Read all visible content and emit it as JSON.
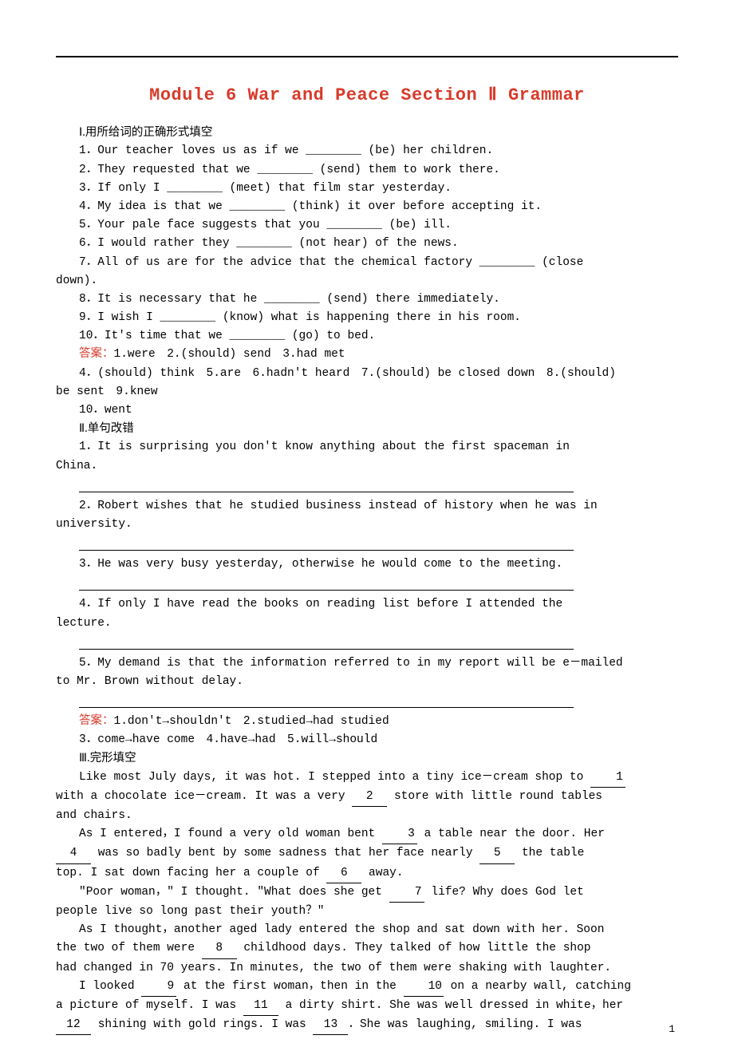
{
  "title": "Module 6 War and Peace Section Ⅱ Grammar",
  "sec1": {
    "head": "Ⅰ.用所给词的正确形式填空",
    "q1": "1．Our teacher loves us as if we ________ (be) her children.",
    "q2": "2．They requested that we ________ (send) them to work there.",
    "q3": "3．If only I ________ (meet) that film star yesterday.",
    "q4": "4．My idea is that we ________ (think) it over before accepting it.",
    "q5": "5．Your pale face suggests that you ________ (be) ill.",
    "q6": "6．I would rather they ________ (not hear) of the news.",
    "q7a": "7．All of us are for the advice that the chemical factory ________ (close",
    "q7b": "down).",
    "q8": "8．It is necessary that he ________ (send) there immediately.",
    "q9": "9．I wish I ________ (know) what is happening there in his room.",
    "q10": "10．It's time that we ________ (go) to bed.",
    "ans_label": "答案：",
    "ans_line1": "1.were　2.(should) send　3.had met",
    "ans_line2": "4．(should) think　5.are　6.hadn't heard　7.(should) be closed down　8.(should)",
    "ans_line2b": "be sent　9.knew",
    "ans_line3": "10．went"
  },
  "sec2": {
    "head": "Ⅱ.单句改错",
    "q1a": "1．It is surprising you don't know anything about the first spaceman in",
    "q1b": "China.",
    "q2a": "2．Robert wishes that he studied business instead of history when he was in",
    "q2b": "university.",
    "q3": "3．He was very busy yesterday, otherwise he would come to the meeting.",
    "q4a": "4．If only I have read the books on reading list before I attended the",
    "q4b": "lecture.",
    "q5a": "5．My demand is that the information referred to in my report will be e－mailed",
    "q5b": "to Mr. Brown without delay.",
    "ans_label": "答案：",
    "ans_line1": "1.don't→shouldn't　2.studied→had studied",
    "ans_line2": "3．come→have come　4.have→had　5.will→should"
  },
  "sec3": {
    "head": "Ⅲ.完形填空",
    "p1a": "Like most July days, it was hot. I stepped into a tiny ice－cream shop to ",
    "p1b": "with a chocolate ice－cream. It was a very ",
    "p1c": " store with little round tables",
    "p1d": "and chairs.",
    "p2a": "As I entered，I found a very old woman bent ",
    "p2b": " a table near the door. Her",
    "p2c": " was so badly bent by some sadness that her face nearly ",
    "p2d": " the table",
    "p2e": "top. I sat down facing her a couple of ",
    "p2f": " away.",
    "p3a": "\"Poor woman，\" I thought. \"What does she get ",
    "p3b": " life? Why does God let",
    "p3c": "people live so long past their youth？\"",
    "p4a": "As I thought，another aged lady entered the shop and sat down with her. Soon",
    "p4b": "the two of them were ",
    "p4c": " childhood days. They talked of how little the shop",
    "p4d": "had changed in 70 years. In minutes, the two of them were shaking with laughter.",
    "p5a": "I looked ",
    "p5b": " at the first woman，then in the ",
    "p5c": " on a nearby wall, catching",
    "p5d": "a picture of myself. I was ",
    "p5e": " a dirty shirt. She was well dressed in white，her",
    "p5f": " shining with gold rings. I was ",
    "p5g": "．She was laughing, smiling. I was",
    "n1": "1",
    "n2": "2",
    "n3": "3",
    "n4": "4",
    "n5": "5",
    "n6": "6",
    "n7": "7",
    "n8": "8",
    "n9": "9",
    "n10": "10",
    "n11": "11",
    "n12": "12",
    "n13": "13"
  },
  "pagenum": "1"
}
